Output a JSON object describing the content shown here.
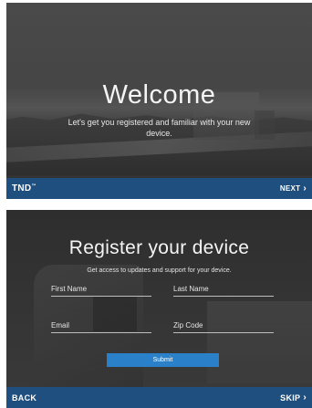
{
  "welcome_screen": {
    "title": "Welcome",
    "subtitle": "Let's get you registered and familiar with your new device.",
    "brand": "TND",
    "brand_mark": "™",
    "next_label": "NEXT",
    "next_icon": "chevron-right-icon"
  },
  "register_screen": {
    "title": "Register your device",
    "subtitle": "Get access to updates and support for your device.",
    "fields": {
      "first_name": {
        "placeholder": "First Name",
        "value": ""
      },
      "last_name": {
        "placeholder": "Last Name",
        "value": ""
      },
      "email": {
        "placeholder": "Email",
        "value": ""
      },
      "zip_code": {
        "placeholder": "Zip Code",
        "value": ""
      }
    },
    "submit_label": "Submit",
    "back_label": "BACK",
    "skip_label": "SKIP",
    "skip_icon": "chevron-right-icon"
  },
  "colors": {
    "bar": "#1f4f7e",
    "submit": "#2a80c9",
    "background": "#3f3f3f"
  }
}
